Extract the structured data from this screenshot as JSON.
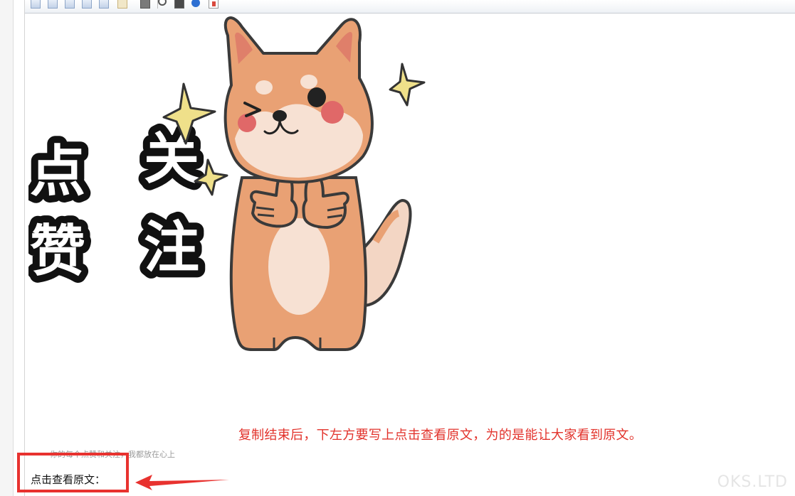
{
  "toolbar": {
    "buttons": [
      {
        "name": "table-button",
        "icon": "table-icon"
      },
      {
        "name": "insert-row-button",
        "icon": "table-row-icon"
      },
      {
        "name": "insert-col-button",
        "icon": "table-col-icon"
      },
      {
        "name": "merge-cells-button",
        "icon": "table-merge-icon"
      },
      {
        "name": "split-cells-button",
        "icon": "table-split-icon"
      },
      {
        "name": "template-doc-button",
        "icon": "document-icon"
      },
      {
        "name": "print-button",
        "icon": "print-icon"
      },
      {
        "name": "preview-button",
        "icon": "magnifier-icon"
      },
      {
        "name": "template-button",
        "icon": "template-icon"
      },
      {
        "name": "help-button",
        "icon": "help-icon"
      },
      {
        "name": "paste-word-button",
        "icon": "paste-icon"
      }
    ]
  },
  "sticker": {
    "text_chars": [
      "点",
      "赞",
      "关",
      "注"
    ]
  },
  "caption": "复制结束后，下左方要写上点击查看原文，为的是能让大家看到原文。",
  "faint_line": "你的每个点赞和关注，我都放在心上",
  "read_more": "点击查看原文：",
  "watermark": "OKS.LTD",
  "colors": {
    "caption": "#e2322b",
    "highlight_box": "#e8322f",
    "dog_fur": "#e9a174",
    "dog_belly": "#f7e1d3",
    "star": "#efe08a"
  }
}
